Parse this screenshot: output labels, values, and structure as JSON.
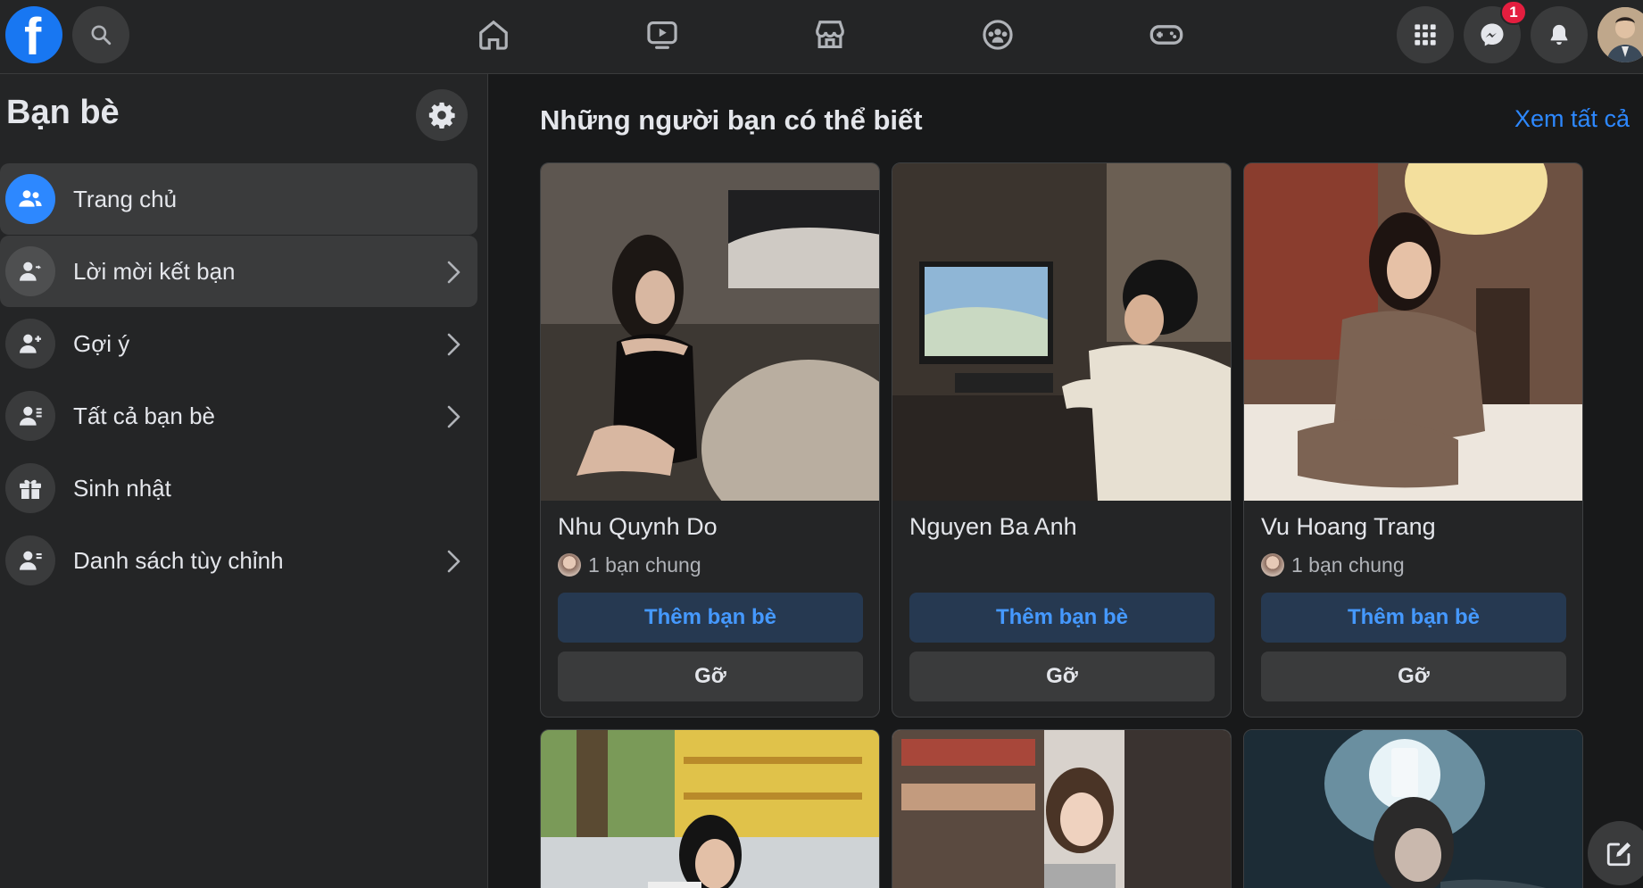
{
  "topbar": {
    "logo_letter": "f",
    "messenger_badge": "1",
    "icons": [
      "search-icon",
      "home-icon",
      "watch-icon",
      "marketplace-icon",
      "groups-icon",
      "gaming-icon",
      "menu-grid-icon",
      "messenger-icon",
      "bell-icon"
    ]
  },
  "sidebar": {
    "title": "Bạn bè",
    "items": [
      {
        "label": "Trang chủ",
        "icon": "friends-home-icon",
        "chevron": false,
        "state": "active"
      },
      {
        "label": "Lời mời kết bạn",
        "icon": "friend-request-icon",
        "chevron": true,
        "state": "hover"
      },
      {
        "label": "Gợi ý",
        "icon": "add-friend-icon",
        "chevron": true,
        "state": "normal"
      },
      {
        "label": "Tất cả bạn bè",
        "icon": "friend-list-icon",
        "chevron": true,
        "state": "normal"
      },
      {
        "label": "Sinh nhật",
        "icon": "gift-icon",
        "chevron": false,
        "state": "normal"
      },
      {
        "label": "Danh sách tùy chỉnh",
        "icon": "custom-list-icon",
        "chevron": true,
        "state": "normal"
      }
    ]
  },
  "main": {
    "section_title": "Những người bạn có thể biết",
    "see_all": "Xem tất cả",
    "cards": [
      {
        "name": "Nhu Quynh Do",
        "mutual": "1 bạn chung",
        "add": "Thêm bạn bè",
        "remove": "Gỡ"
      },
      {
        "name": "Nguyen Ba Anh",
        "mutual": "",
        "add": "Thêm bạn bè",
        "remove": "Gỡ"
      },
      {
        "name": "Vu Hoang Trang",
        "mutual": "1 bạn chung",
        "add": "Thêm bạn bè",
        "remove": "Gỡ"
      }
    ]
  },
  "colors": {
    "accent": "#2d88ff",
    "background": "#18191a",
    "surface": "#242526",
    "badge": "#e41e3f"
  }
}
